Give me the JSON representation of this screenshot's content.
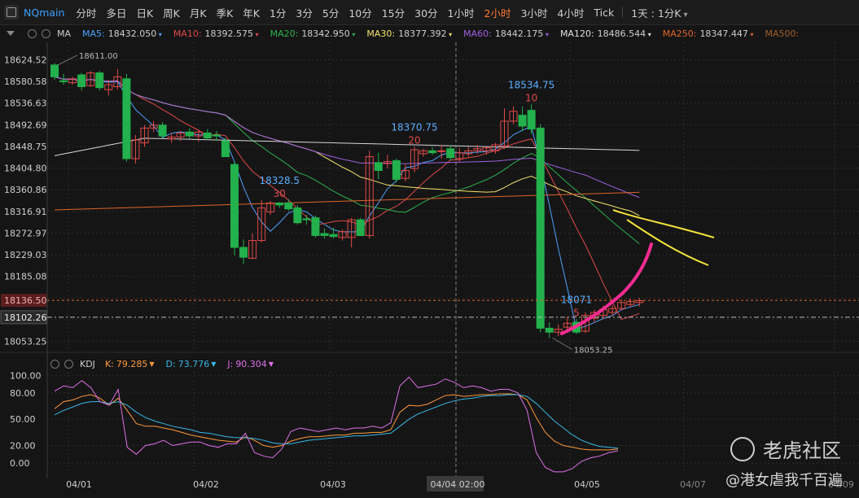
{
  "toolbar": {
    "symbol": "NQmain",
    "periods": [
      "分时",
      "多日",
      "日K",
      "周K",
      "月K",
      "季K",
      "年K",
      "1分",
      "3分",
      "5分",
      "10分",
      "15分",
      "30分",
      "1小时",
      "2小时",
      "3小时",
      "4小时",
      "Tick"
    ],
    "active_period": "2小时",
    "interval_select": "1天 : 1分K"
  },
  "ma_legend": [
    {
      "label": "MA",
      "value": "",
      "color": "#cfcfcf"
    },
    {
      "label": "MA5:",
      "value": "18432.050",
      "color": "#4da3ff"
    },
    {
      "label": "MA10:",
      "value": "18392.575",
      "color": "#e04a4a"
    },
    {
      "label": "MA20:",
      "value": "18342.950",
      "color": "#2fb14f"
    },
    {
      "label": "MA30:",
      "value": "18377.392",
      "color": "#f5e36b"
    },
    {
      "label": "MA60:",
      "value": "18442.175",
      "color": "#a060e0"
    },
    {
      "label": "MA120:",
      "value": "18486.544",
      "color": "#e0e0e0"
    },
    {
      "label": "MA250:",
      "value": "18347.447",
      "color": "#e0642a"
    },
    {
      "label": "MA500:",
      "value": "",
      "color": "#a0602a"
    }
  ],
  "kdj_legend": {
    "name": "KDJ",
    "k_label": "K:",
    "k_value": "79.285",
    "k_color": "#ff9a3c",
    "d_label": "D:",
    "d_value": "73.776",
    "d_color": "#38b8e8",
    "j_label": "J:",
    "j_value": "90.304",
    "j_color": "#e070e8"
  },
  "colors": {
    "up": "#e04a4a",
    "down": "#22b14c",
    "bg": "#151515",
    "grid": "#2e2e2e",
    "axis_text": "#cfcfcf"
  },
  "chart_data": [
    {
      "type": "candlestick",
      "y_ticks": [
        18624.52,
        18580.58,
        18536.63,
        18492.69,
        18448.75,
        18404.8,
        18360.86,
        18316.91,
        18272.97,
        18229.03,
        18185.08,
        18141.14,
        18097.19,
        18053.25
      ],
      "y_tick_labels": [
        "18624.52",
        "18580.58",
        "18536.63",
        "18492.69",
        "18448.75",
        "18404.80",
        "18360.86",
        "18316.91",
        "18272.97",
        "18229.03",
        "18185.08",
        "",
        "",
        "18053.25"
      ],
      "ylim": [
        18036,
        18660
      ],
      "x_labels": [
        "04/01",
        "04/02",
        "04/03",
        "04/04 02:00",
        "04/05",
        "04/07",
        "04/09"
      ],
      "current_price": "18136.50",
      "crosshair_price": "18102.26",
      "candles": [
        {
          "o": 18614,
          "h": 18618,
          "l": 18584,
          "c": 18590
        },
        {
          "o": 18582,
          "h": 18596,
          "l": 18574,
          "c": 18580
        },
        {
          "o": 18578,
          "h": 18590,
          "l": 18574,
          "c": 18586
        },
        {
          "o": 18594,
          "h": 18598,
          "l": 18562,
          "c": 18570
        },
        {
          "o": 18572,
          "h": 18602,
          "l": 18570,
          "c": 18598
        },
        {
          "o": 18598,
          "h": 18602,
          "l": 18562,
          "c": 18568
        },
        {
          "o": 18564,
          "h": 18584,
          "l": 18552,
          "c": 18574
        },
        {
          "o": 18570,
          "h": 18606,
          "l": 18564,
          "c": 18590
        },
        {
          "o": 18586,
          "h": 18596,
          "l": 18418,
          "c": 18424
        },
        {
          "o": 18424,
          "h": 18472,
          "l": 18414,
          "c": 18462
        },
        {
          "o": 18456,
          "h": 18492,
          "l": 18448,
          "c": 18486
        },
        {
          "o": 18486,
          "h": 18500,
          "l": 18478,
          "c": 18492
        },
        {
          "o": 18492,
          "h": 18498,
          "l": 18466,
          "c": 18470
        },
        {
          "o": 18464,
          "h": 18476,
          "l": 18456,
          "c": 18468
        },
        {
          "o": 18468,
          "h": 18480,
          "l": 18460,
          "c": 18476
        },
        {
          "o": 18478,
          "h": 18486,
          "l": 18464,
          "c": 18470
        },
        {
          "o": 18470,
          "h": 18482,
          "l": 18458,
          "c": 18478
        },
        {
          "o": 18476,
          "h": 18484,
          "l": 18462,
          "c": 18466
        },
        {
          "o": 18472,
          "h": 18480,
          "l": 18460,
          "c": 18470
        },
        {
          "o": 18460,
          "h": 18466,
          "l": 18428,
          "c": 18428
        },
        {
          "o": 18412,
          "h": 18418,
          "l": 18228,
          "c": 18244
        },
        {
          "o": 18244,
          "h": 18260,
          "l": 18210,
          "c": 18224
        },
        {
          "o": 18222,
          "h": 18272,
          "l": 18220,
          "c": 18258
        },
        {
          "o": 18258,
          "h": 18340,
          "l": 18254,
          "c": 18324
        },
        {
          "o": 18316,
          "h": 18338,
          "l": 18310,
          "c": 18334
        },
        {
          "o": 18334,
          "h": 18336,
          "l": 18324,
          "c": 18330
        },
        {
          "o": 18334,
          "h": 18342,
          "l": 18318,
          "c": 18322
        },
        {
          "o": 18324,
          "h": 18330,
          "l": 18290,
          "c": 18294
        },
        {
          "o": 18302,
          "h": 18310,
          "l": 18290,
          "c": 18300
        },
        {
          "o": 18304,
          "h": 18308,
          "l": 18264,
          "c": 18268
        },
        {
          "o": 18272,
          "h": 18282,
          "l": 18262,
          "c": 18268
        },
        {
          "o": 18270,
          "h": 18284,
          "l": 18262,
          "c": 18266
        },
        {
          "o": 18264,
          "h": 18280,
          "l": 18258,
          "c": 18276
        },
        {
          "o": 18264,
          "h": 18304,
          "l": 18244,
          "c": 18300
        },
        {
          "o": 18300,
          "h": 18304,
          "l": 18268,
          "c": 18268
        },
        {
          "o": 18268,
          "h": 18440,
          "l": 18262,
          "c": 18428
        },
        {
          "o": 18416,
          "h": 18436,
          "l": 18382,
          "c": 18400
        },
        {
          "o": 18414,
          "h": 18432,
          "l": 18404,
          "c": 18418
        },
        {
          "o": 18420,
          "h": 18424,
          "l": 18376,
          "c": 18382
        },
        {
          "o": 18384,
          "h": 18412,
          "l": 18378,
          "c": 18400
        },
        {
          "o": 18404,
          "h": 18448,
          "l": 18396,
          "c": 18442
        },
        {
          "o": 18434,
          "h": 18444,
          "l": 18428,
          "c": 18440
        },
        {
          "o": 18440,
          "h": 18448,
          "l": 18432,
          "c": 18436
        },
        {
          "o": 18440,
          "h": 18452,
          "l": 18424,
          "c": 18440
        },
        {
          "o": 18444,
          "h": 18450,
          "l": 18420,
          "c": 18426
        },
        {
          "o": 18424,
          "h": 18446,
          "l": 18418,
          "c": 18436
        },
        {
          "o": 18434,
          "h": 18448,
          "l": 18428,
          "c": 18440
        },
        {
          "o": 18440,
          "h": 18452,
          "l": 18434,
          "c": 18444
        },
        {
          "o": 18440,
          "h": 18448,
          "l": 18432,
          "c": 18446
        },
        {
          "o": 18440,
          "h": 18456,
          "l": 18434,
          "c": 18452
        },
        {
          "o": 18450,
          "h": 18526,
          "l": 18444,
          "c": 18500
        },
        {
          "o": 18500,
          "h": 18530,
          "l": 18494,
          "c": 18520
        },
        {
          "o": 18512,
          "h": 18530,
          "l": 18480,
          "c": 18490
        },
        {
          "o": 18522,
          "h": 18534,
          "l": 18474,
          "c": 18484
        },
        {
          "o": 18486,
          "h": 18494,
          "l": 18072,
          "c": 18080
        },
        {
          "o": 18080,
          "h": 18092,
          "l": 18060,
          "c": 18072
        },
        {
          "o": 18072,
          "h": 18088,
          "l": 18064,
          "c": 18078
        },
        {
          "o": 18082,
          "h": 18104,
          "l": 18072,
          "c": 18090
        },
        {
          "o": 18092,
          "h": 18098,
          "l": 18068,
          "c": 18072
        },
        {
          "o": 18074,
          "h": 18112,
          "l": 18070,
          "c": 18106
        },
        {
          "o": 18100,
          "h": 18118,
          "l": 18092,
          "c": 18112
        },
        {
          "o": 18106,
          "h": 18126,
          "l": 18098,
          "c": 18118
        },
        {
          "o": 18112,
          "h": 18126,
          "l": 18104,
          "c": 18120
        },
        {
          "o": 18120,
          "h": 18138,
          "l": 18116,
          "c": 18132
        },
        {
          "o": 18128,
          "h": 18140,
          "l": 18122,
          "c": 18134
        },
        {
          "o": 18132,
          "h": 18142,
          "l": 18124,
          "c": 18136
        }
      ],
      "annotations": [
        {
          "text": "18611.00",
          "type": "high",
          "i": 0,
          "price": 18614
        },
        {
          "text": "18534.75",
          "type": "peak",
          "i": 53,
          "price": 18534
        },
        {
          "text": "10",
          "type": "peak_sub",
          "i": 53,
          "price": 18534
        },
        {
          "text": "18370.75",
          "type": "peak",
          "i": 40,
          "price": 18448
        },
        {
          "text": "20",
          "type": "peak_sub",
          "i": 40,
          "price": 18448
        },
        {
          "text": "18328.5",
          "type": "peak",
          "i": 25,
          "price": 18340
        },
        {
          "text": "30",
          "type": "peak_sub",
          "i": 25,
          "price": 18340
        },
        {
          "text": "18071",
          "type": "peak",
          "i": 58,
          "price": 18098
        },
        {
          "text": "5",
          "type": "peak_sub",
          "i": 58,
          "price": 18098
        },
        {
          "text": "18053.25",
          "type": "low",
          "i": 55,
          "price": 18060
        }
      ]
    },
    {
      "type": "line",
      "name": "KDJ",
      "y_ticks": [
        100,
        80,
        50,
        20,
        0
      ],
      "y_tick_labels": [
        "100.00",
        "80.00",
        "50.00",
        "20.00",
        "0.00"
      ],
      "ylim": [
        -12,
        104
      ],
      "series": [
        {
          "name": "K",
          "color": "#ff9a3c",
          "values": [
            62,
            70,
            72,
            76,
            78,
            74,
            66,
            74,
            60,
            45,
            42,
            42,
            40,
            38,
            35,
            32,
            30,
            28,
            26,
            25,
            24,
            30,
            26,
            20,
            18,
            20,
            25,
            28,
            30,
            30,
            31,
            32,
            32,
            34,
            34,
            35,
            35,
            38,
            58,
            66,
            65,
            67,
            72,
            77,
            78,
            76,
            77,
            78,
            78,
            79,
            79,
            78,
            72,
            52,
            35,
            25,
            20,
            18,
            16,
            15,
            15,
            15,
            16
          ]
        },
        {
          "name": "D",
          "color": "#38b8e8",
          "values": [
            55,
            60,
            64,
            68,
            70,
            70,
            68,
            70,
            66,
            58,
            52,
            48,
            45,
            42,
            40,
            38,
            35,
            34,
            32,
            30,
            29,
            29,
            28,
            26,
            23,
            22,
            22,
            24,
            26,
            27,
            28,
            29,
            30,
            31,
            31,
            32,
            33,
            34,
            42,
            50,
            56,
            60,
            64,
            68,
            71,
            73,
            74,
            76,
            77,
            77,
            78,
            78,
            76,
            68,
            58,
            48,
            40,
            32,
            26,
            22,
            19,
            18,
            17
          ]
        },
        {
          "name": "J",
          "color": "#e070e8",
          "values": [
            82,
            88,
            86,
            94,
            86,
            70,
            66,
            84,
            18,
            10,
            20,
            22,
            26,
            20,
            22,
            24,
            24,
            20,
            18,
            22,
            22,
            34,
            12,
            8,
            6,
            16,
            36,
            40,
            38,
            36,
            38,
            40,
            38,
            40,
            40,
            42,
            40,
            46,
            88,
            98,
            86,
            88,
            90,
            96,
            92,
            86,
            88,
            86,
            82,
            84,
            84,
            80,
            60,
            12,
            -5,
            -10,
            -10,
            -6,
            2,
            6,
            8,
            12,
            14
          ]
        }
      ],
      "x_labels": [
        "04/01",
        "04/02",
        "04/03",
        "04/04 02:00",
        "04/05",
        "04/07",
        "04/09"
      ]
    }
  ],
  "watermark": {
    "brand": "老虎社区",
    "user": "@港女虐我千百遍"
  }
}
